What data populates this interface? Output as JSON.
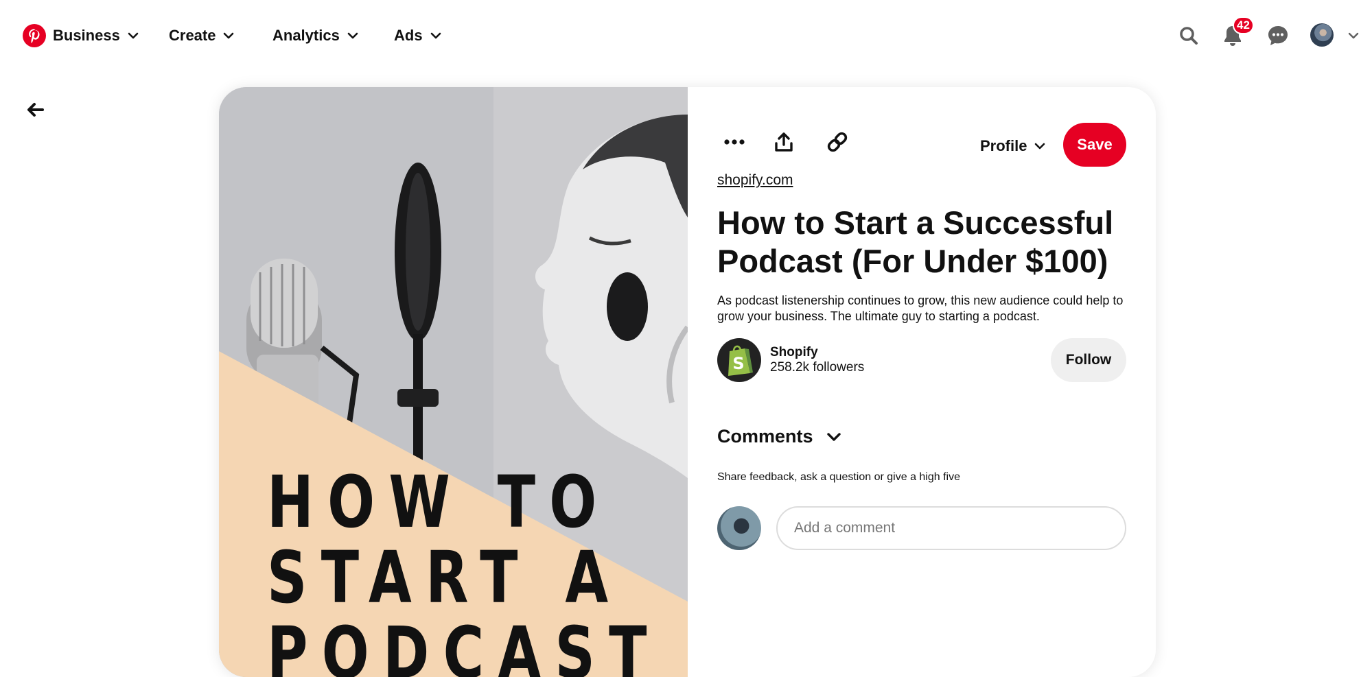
{
  "nav": {
    "items": [
      {
        "label": "Business"
      },
      {
        "label": "Create"
      },
      {
        "label": "Analytics"
      },
      {
        "label": "Ads"
      }
    ],
    "notifications_count": "42"
  },
  "pin": {
    "image_text": "HOW TO\nSTART A\nPODCAST",
    "profile_label": "Profile",
    "save_label": "Save",
    "source": "shopify.com",
    "title": "How to Start a Successful Podcast (For Under $100)",
    "description": "As podcast listenership continues to grow, this new audience could help to grow your business. The ultimate guy to starting a podcast.",
    "creator": {
      "name": "Shopify",
      "followers": "258.2k followers",
      "follow_label": "Follow"
    },
    "comments": {
      "heading": "Comments",
      "hint": "Share feedback, ask a question or give a high five",
      "input_placeholder": "Add a comment"
    }
  },
  "colors": {
    "brand_red": "#e60023",
    "image_peach": "#f5d6b3",
    "follow_bg": "#efefef"
  }
}
